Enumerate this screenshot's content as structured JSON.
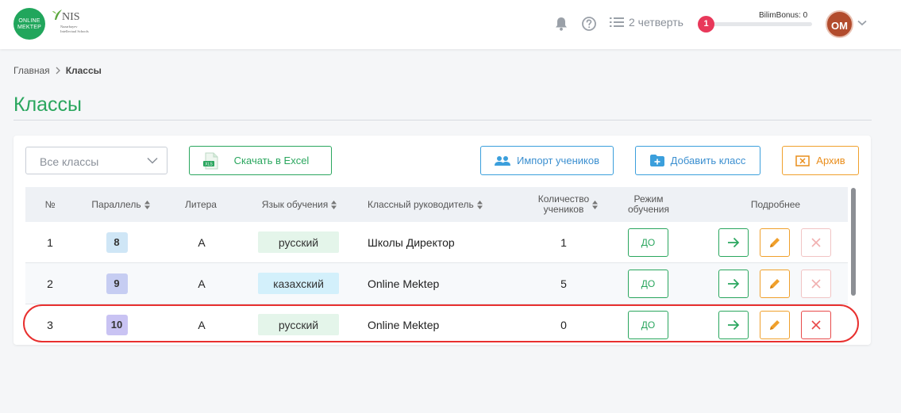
{
  "header": {
    "logo_online_mektep": "ONLINE MEKTEP",
    "logo_nis": "NIS",
    "logo_nis_sub": "Nazarbayev Intellectual Schools",
    "quarter_label": "2 четверть",
    "notification_count": "1",
    "bonus_label": "BilimBonus: 0",
    "bonus_progress": 0,
    "avatar_initials": "OM",
    "icons": [
      "bell-icon",
      "help-circle-icon",
      "list-icon",
      "chevron-down-icon"
    ]
  },
  "breadcrumb": {
    "home": "Главная",
    "current": "Классы"
  },
  "page_title": "Классы",
  "toolbar": {
    "filter_value": "Все классы",
    "excel_label": "Скачать в Excel",
    "import_label": "Импорт учеников",
    "add_class_label": "Добавить класс",
    "archive_label": "Архив"
  },
  "table": {
    "columns": {
      "num": "№",
      "parallel": "Параллель",
      "litera": "Литера",
      "language": "Язык обучения",
      "teacher": "Классный руководитель",
      "count_line1": "Количество",
      "count_line2": "учеников",
      "mode_line1": "Режим",
      "mode_line2": "обучения",
      "details": "Подробнее"
    },
    "rows": [
      {
        "num": "1",
        "grade": "8",
        "litera": "А",
        "language": "русский",
        "teacher": "Школы Директор",
        "count": "1",
        "mode": "ДО",
        "delete_enabled": false
      },
      {
        "num": "2",
        "grade": "9",
        "litera": "А",
        "language": "казахский",
        "teacher": "Online Mektep",
        "count": "5",
        "mode": "ДО",
        "delete_enabled": false
      },
      {
        "num": "3",
        "grade": "10",
        "litera": "А",
        "language": "русский",
        "teacher": "Online Mektep",
        "count": "0",
        "mode": "ДО",
        "delete_enabled": true
      }
    ]
  },
  "colors": {
    "accent_green": "#2aa65e",
    "accent_blue": "#3b9fdc",
    "accent_orange": "#f0a02c",
    "danger_red": "#e84a4a",
    "highlight_ring": "#e8302f",
    "grade_8_bg": "#cfe6f6",
    "grade_9_bg": "#c6cdf2",
    "grade_10_bg": "#c9c3f3",
    "lang_russian_bg": "#e4f5ea",
    "lang_kazakh_bg": "#d3f0fb"
  }
}
